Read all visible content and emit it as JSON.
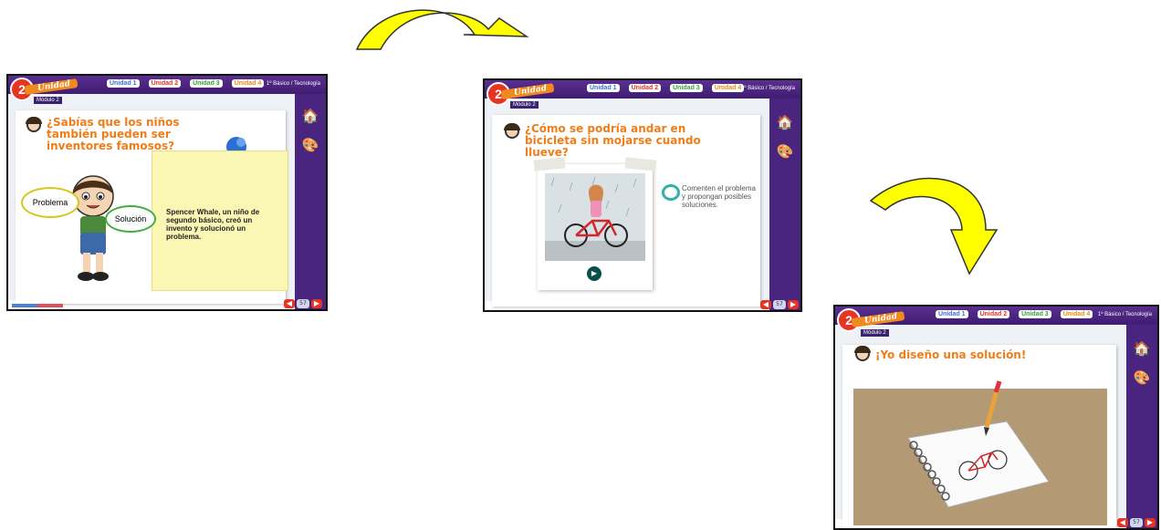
{
  "common": {
    "tabs": [
      {
        "label": "Unidad 1",
        "color": "#3b6fd4"
      },
      {
        "label": "Unidad 2",
        "color": "#e0342d"
      },
      {
        "label": "Unidad 3",
        "color": "#39a13a"
      },
      {
        "label": "Unidad 4",
        "color": "#e88b14"
      }
    ],
    "grade": "1º Básico / Tecnología",
    "unit_number": "2",
    "unit_label": "Unidad",
    "module_label": "Módulo 2",
    "page_number": "57",
    "nav_prev": "◀",
    "nav_next": "▶"
  },
  "slide1": {
    "question": "¿Sabías que los niños también pueden ser inventores famosos?",
    "bubble_problem": "Problema",
    "bubble_solution": "Solución",
    "note_text": "Spencer Whale, un niño de segundo básico, creó un invento y solucionó un problema."
  },
  "slide2": {
    "question": "¿Cómo se podría andar en bicicleta sin mojarse cuando llueve?",
    "prompt": "Comenten el problema y propongan posibles soluciones."
  },
  "slide3": {
    "question": "¡Yo diseño una solución!"
  },
  "colors": {
    "arrow": "#ffff00",
    "brand_purple": "#4a2580",
    "accent_orange": "#f07d18",
    "badge_red": "#e53421"
  }
}
